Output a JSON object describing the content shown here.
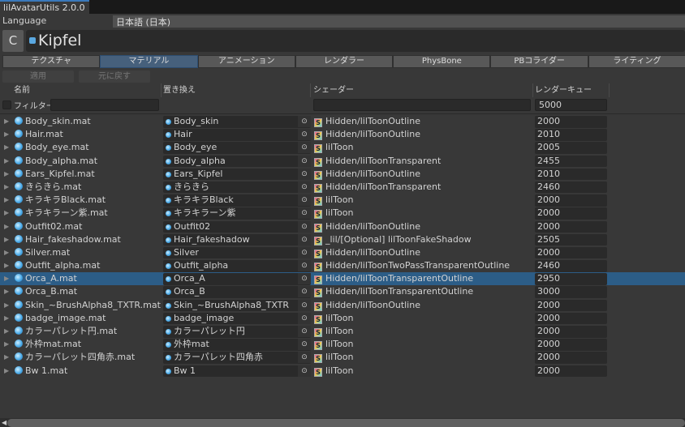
{
  "window": {
    "title": "lilAvatarUtils 2.0.0"
  },
  "language": {
    "label": "Language",
    "value": "日本語 (日本)"
  },
  "avatar": {
    "refresh_icon": "C",
    "name": "Kipfel"
  },
  "tabs": [
    "テクスチャ",
    "マテリアル",
    "アニメーション",
    "レンダラー",
    "PhysBone",
    "PBコライダー",
    "ライティング"
  ],
  "selected_tab": 1,
  "actions": {
    "apply": "適用",
    "revert": "元に戻す"
  },
  "columns": {
    "name": "名前",
    "replace": "置き換え",
    "shader": "シェーダー",
    "queue": "レンダーキュー"
  },
  "filter": {
    "label": "フィルター",
    "name": "",
    "shader": "",
    "queue": "5000"
  },
  "selected_row": 12,
  "rows": [
    {
      "name": "Body_skin.mat",
      "replace": "Body_skin",
      "shader": "Hidden/lilToonOutline",
      "queue": "2000"
    },
    {
      "name": "Hair.mat",
      "replace": "Hair",
      "shader": "Hidden/lilToonOutline",
      "queue": "2010"
    },
    {
      "name": "Body_eye.mat",
      "replace": "Body_eye",
      "shader": "lilToon",
      "queue": "2005"
    },
    {
      "name": "Body_alpha.mat",
      "replace": "Body_alpha",
      "shader": "Hidden/lilToonTransparent",
      "queue": "2455"
    },
    {
      "name": "Ears_Kipfel.mat",
      "replace": "Ears_Kipfel",
      "shader": "Hidden/lilToonOutline",
      "queue": "2010"
    },
    {
      "name": "きらきら.mat",
      "replace": "きらきら",
      "shader": "Hidden/lilToonTransparent",
      "queue": "2460"
    },
    {
      "name": "キラキラBlack.mat",
      "replace": "キラキラBlack",
      "shader": "lilToon",
      "queue": "2000"
    },
    {
      "name": "キラキラーン紫.mat",
      "replace": "キラキラーン紫",
      "shader": "lilToon",
      "queue": "2000"
    },
    {
      "name": "Outfit02.mat",
      "replace": "Outfit02",
      "shader": "Hidden/lilToonOutline",
      "queue": "2000"
    },
    {
      "name": "Hair_fakeshadow.mat",
      "replace": "Hair_fakeshadow",
      "shader": "_lil/[Optional] lilToonFakeShadow",
      "queue": "2505"
    },
    {
      "name": "Silver.mat",
      "replace": "Silver",
      "shader": "Hidden/lilToonOutline",
      "queue": "2000"
    },
    {
      "name": "Outfit_alpha.mat",
      "replace": "Outfit_alpha",
      "shader": "Hidden/lilToonTwoPassTransparentOutline",
      "queue": "2460"
    },
    {
      "name": "Orca_A.mat",
      "replace": "Orca_A",
      "shader": "Hidden/lilToonTransparentOutline",
      "queue": "2950"
    },
    {
      "name": "Orca_B.mat",
      "replace": "Orca_B",
      "shader": "Hidden/lilToonTransparentOutline",
      "queue": "3000"
    },
    {
      "name": "Skin_~BrushAlpha8_TXTR.mat",
      "replace": "Skin_~BrushAlpha8_TXTR",
      "shader": "Hidden/lilToonOutline",
      "queue": "2000"
    },
    {
      "name": "badge_image.mat",
      "replace": "badge_image",
      "shader": "lilToon",
      "queue": "2000"
    },
    {
      "name": "カラーパレット円.mat",
      "replace": "カラーパレット円",
      "shader": "lilToon",
      "queue": "2000"
    },
    {
      "name": "外枠mat.mat",
      "replace": "外枠mat",
      "shader": "lilToon",
      "queue": "2000"
    },
    {
      "name": "カラーパレット四角赤.mat",
      "replace": "カラーパレット四角赤",
      "shader": "lilToon",
      "queue": "2000"
    },
    {
      "name": "Bw 1.mat",
      "replace": "Bw 1",
      "shader": "lilToon",
      "queue": "2000"
    }
  ]
}
